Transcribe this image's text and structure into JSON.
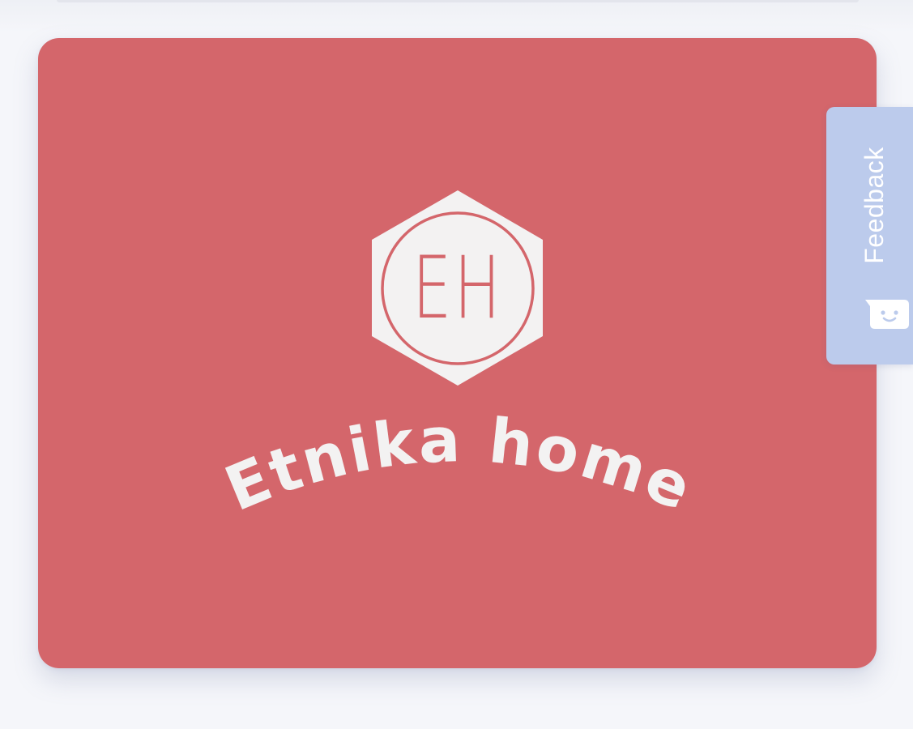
{
  "logo": {
    "monogram": "EH",
    "brand_name": "Etnika home"
  },
  "feedback": {
    "label": "Feedback",
    "icon": "smiley-chat-icon"
  },
  "colors": {
    "logo_background": "#d4666b",
    "logo_foreground": "#f3f2f2",
    "feedback_tab": "#bccbec",
    "feedback_text": "#ffffff",
    "page_background": "#f5f6fa"
  }
}
